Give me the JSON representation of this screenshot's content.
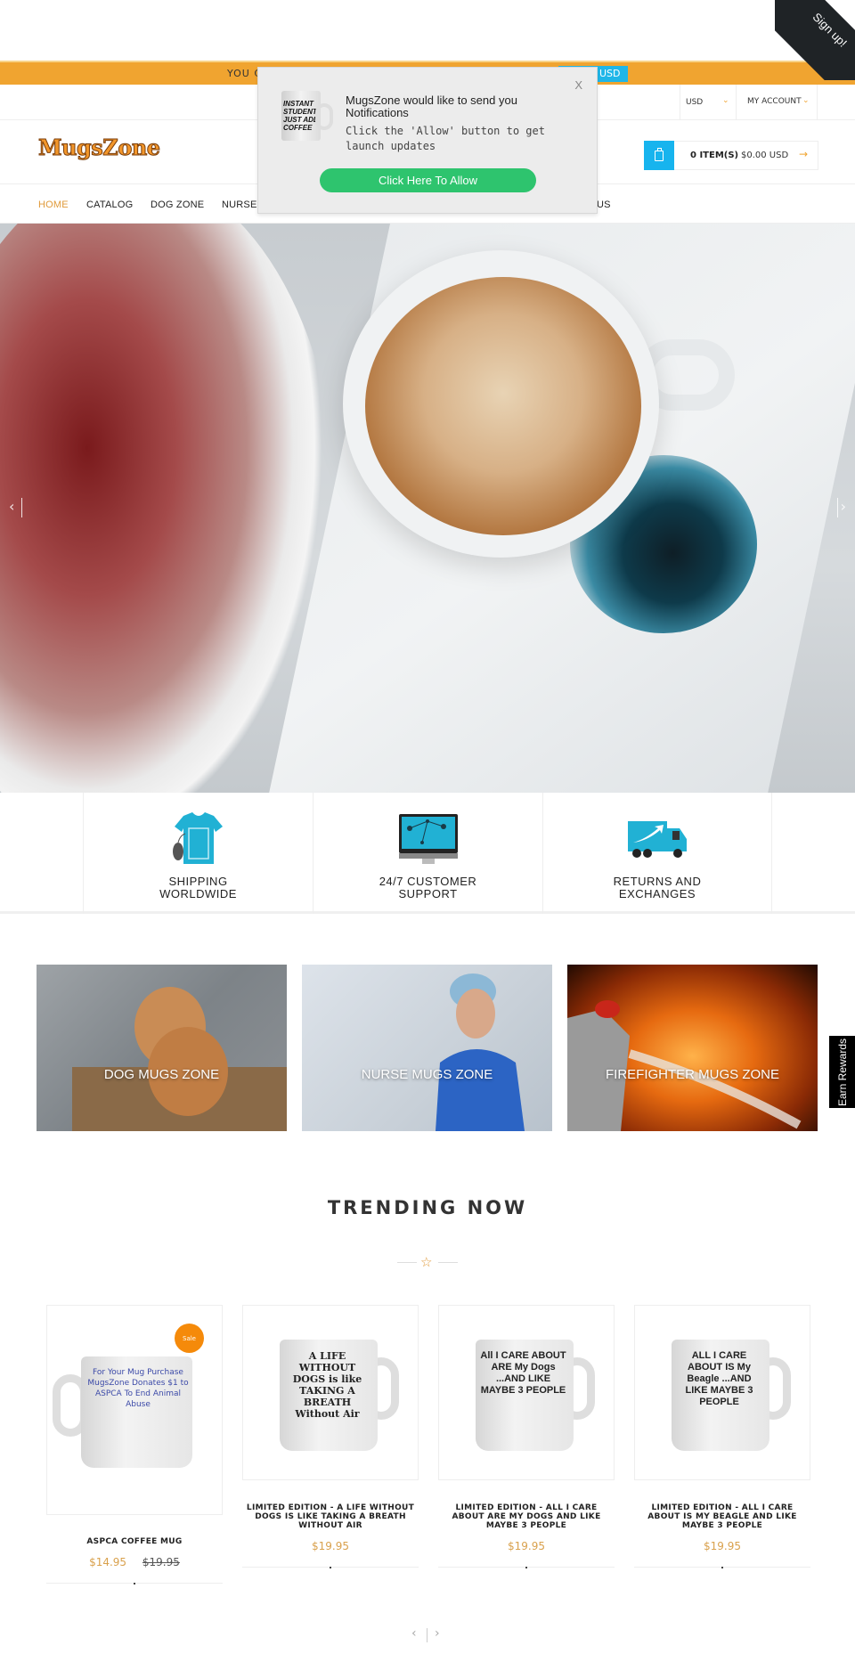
{
  "signup_ribbon": {
    "label": "Sign up!"
  },
  "promo_bar": {
    "text": "YOU C",
    "currency_badge": "USD"
  },
  "topbar": {
    "currency": {
      "selected": "USD"
    },
    "account_label": "MY ACCOUNT"
  },
  "header": {
    "logo": "MugsZone",
    "cart": {
      "items": "0 ITEM(S)",
      "total": "$0.00 USD",
      "arrow": "→"
    }
  },
  "nav": {
    "items": [
      {
        "label": "HOME",
        "active": true
      },
      {
        "label": "CATALOG"
      },
      {
        "label": "DOG ZONE"
      },
      {
        "label": "NURSE"
      },
      {
        "label": "US"
      }
    ]
  },
  "hero": {
    "prev": "‹",
    "next": "›"
  },
  "features": [
    {
      "label_line1": "SHIPPING",
      "label_line2": "WORLDWIDE",
      "icon": "tshirt-icon"
    },
    {
      "label_line1": "24/7 CUSTOMER",
      "label_line2": "SUPPORT",
      "icon": "monitor-network-icon"
    },
    {
      "label_line1": "RETURNS AND",
      "label_line2": "EXCHANGES",
      "icon": "delivery-truck-icon"
    }
  ],
  "zones": [
    {
      "label": "DOG MUGS ZONE"
    },
    {
      "label": "NURSE MUGS ZONE"
    },
    {
      "label": "FIREFIGHTER MUGS ZONE"
    }
  ],
  "earn_rewards": "Earn Rewards",
  "trending": {
    "title": "TRENDING NOW",
    "products": [
      {
        "name": "ASPCA COFFEE MUG",
        "price": "$14.95",
        "old_price": "$19.95",
        "badge": "Sale",
        "print": "For Your Mug Purchase MugsZone Donates $1 to ASPCA To End Animal Abuse"
      },
      {
        "name": "LIMITED EDITION - A LIFE WITHOUT DOGS IS LIKE TAKING A BREATH WITHOUT AIR",
        "price": "$19.95",
        "print": "A LIFE WITHOUT DOGS is like TAKING A BREATH Without Air"
      },
      {
        "name": "LIMITED EDITION - ALL I CARE ABOUT ARE MY DOGS AND LIKE MAYBE 3 PEOPLE",
        "price": "$19.95",
        "print": "All I CARE ABOUT ARE My Dogs ...AND LIKE MAYBE 3 PEOPLE"
      },
      {
        "name": "LIMITED EDITION - ALL I CARE ABOUT IS MY BEAGLE AND LIKE MAYBE 3 PEOPLE",
        "price": "$19.95",
        "print": "ALL I CARE ABOUT IS My Beagle ...AND LIKE MAYBE 3 PEOPLE"
      }
    ],
    "pager": {
      "prev": "‹",
      "next": "›"
    }
  },
  "notification": {
    "close": "X",
    "image_text": "INSTANT STUDENT JUST ADD COFFEE",
    "title": "MugsZone would like to send you Notifications",
    "body": "Click the 'Allow' button to get launch updates",
    "allow_button": "Click Here To Allow"
  },
  "colors": {
    "accent": "#f0a430",
    "cart_blue": "#17b4ee",
    "allow_green": "#2ec46e",
    "price": "#d9a14d",
    "sale_badge": "#f58a0a"
  }
}
